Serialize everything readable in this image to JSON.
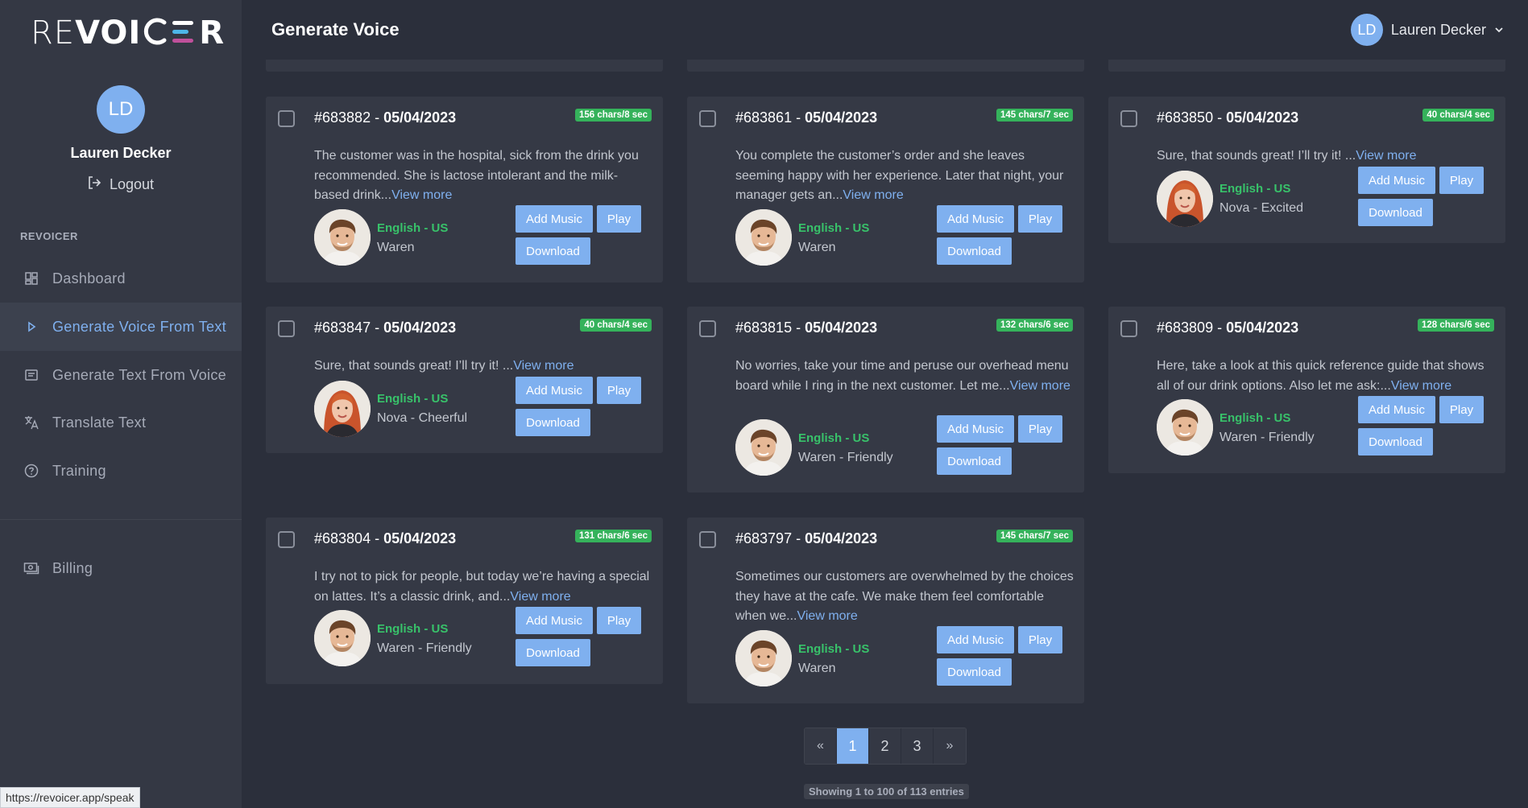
{
  "app": {
    "logo_re": "RE",
    "logo_voi": "VOI",
    "logo_r": "R",
    "colors": {
      "accent": "#7fb0ef",
      "green": "#38c26a",
      "badge": "#35b25b",
      "bg": "#2b2f3b",
      "sidebar": "#343844"
    }
  },
  "sidebar": {
    "avatar_initials": "LD",
    "user_name": "Lauren Decker",
    "logout_label": "Logout",
    "section_label": "REVOICER",
    "items": [
      {
        "label": "Dashboard",
        "icon": "dashboard-icon"
      },
      {
        "label": "Generate Voice From Text",
        "icon": "play-icon"
      },
      {
        "label": "Generate Text From Voice",
        "icon": "text-icon"
      },
      {
        "label": "Translate Text",
        "icon": "translate-icon"
      },
      {
        "label": "Training",
        "icon": "help-icon"
      },
      {
        "label": "Billing",
        "icon": "money-icon"
      }
    ]
  },
  "header": {
    "title": "Generate Voice",
    "user_initials": "LD",
    "user_name": "Lauren Decker"
  },
  "buttons": {
    "add_music": "Add Music",
    "play": "Play",
    "download": "Download",
    "view_more": "View more"
  },
  "cards": [
    {
      "id": "#683882 - ",
      "date": "05/04/2023",
      "badge": "156 chars/8 sec",
      "text": "The customer was in the hospital, sick from the drink you recommended. She is lactose intolerant and the milk-based drink...",
      "lang": "English - US",
      "voice": "Waren",
      "avatar": "male"
    },
    {
      "id": "#683861 - ",
      "date": "05/04/2023",
      "badge": "145 chars/7 sec",
      "text": "You complete the customer’s order and she leaves seeming happy with her experience. Later that night, your manager gets an...",
      "lang": "English - US",
      "voice": "Waren",
      "avatar": "male"
    },
    {
      "id": "#683850 - ",
      "date": "05/04/2023",
      "badge": "40 chars/4 sec",
      "text": "Sure, that sounds great! I’ll try it! ...",
      "lang": "English - US",
      "voice": "Nova - Excited",
      "avatar": "female"
    },
    {
      "id": "#683847 - ",
      "date": "05/04/2023",
      "badge": "40 chars/4 sec",
      "text": "Sure, that sounds great! I’ll try it! ...",
      "lang": "English - US",
      "voice": "Nova - Cheerful",
      "avatar": "female"
    },
    {
      "id": "#683815 - ",
      "date": "05/04/2023",
      "badge": "132 chars/6 sec",
      "text": "No worries, take your time and peruse our overhead menu board while I ring in the next customer. Let me...",
      "lang": "English - US",
      "voice": "Waren - Friendly",
      "avatar": "male"
    },
    {
      "id": "#683809 - ",
      "date": "05/04/2023",
      "badge": "128 chars/6 sec",
      "text": "Here, take a look at this quick reference guide that shows all of our drink options. Also let me ask:...",
      "lang": "English - US",
      "voice": "Waren - Friendly",
      "avatar": "male"
    },
    {
      "id": "#683804 - ",
      "date": "05/04/2023",
      "badge": "131 chars/6 sec",
      "text": "I try not to pick for people, but today we’re having a special on lattes. It’s a classic drink, and...",
      "lang": "English - US",
      "voice": "Waren - Friendly",
      "avatar": "male"
    },
    {
      "id": "#683797 - ",
      "date": "05/04/2023",
      "badge": "145 chars/7 sec",
      "text": "Sometimes our customers are overwhelmed by the choices they have at the cafe. We make them feel comfortable when we...",
      "lang": "English - US",
      "voice": "Waren",
      "avatar": "male"
    }
  ],
  "pagination": {
    "prev": "«",
    "pages": [
      "1",
      "2",
      "3"
    ],
    "current": "1",
    "next": "»",
    "entries": "Showing 1 to 100 of 113 entries"
  },
  "status_url": "https://revoicer.app/speak"
}
